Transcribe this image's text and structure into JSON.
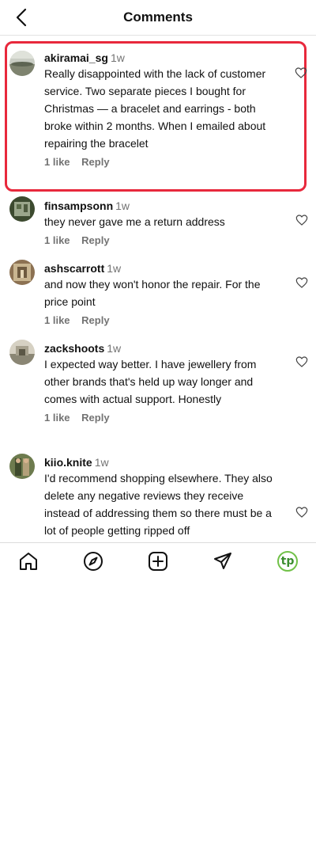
{
  "header": {
    "title": "Comments"
  },
  "comments": [
    {
      "username": "akiramai_sg",
      "time": "1w",
      "text": "Really disappointed with the lack of customer service. Two separate pieces I bought for Christmas — a bracelet and earrings - both broke within 2 months. When I emailed about repairing the bracelet",
      "likes": "1 like",
      "reply": "Reply"
    },
    {
      "username": "finsampsonn",
      "time": "1w",
      "text": "they never gave me a return address",
      "likes": "1 like",
      "reply": "Reply"
    },
    {
      "username": "ashscarrott",
      "time": "1w",
      "text": "and now they won't honor the repair. For the price point",
      "likes": "1 like",
      "reply": "Reply"
    },
    {
      "username": "zackshoots",
      "time": "1w",
      "text": "I expected way better. I have jewellery from other brands that's held up way longer and comes with actual support. Honestly",
      "likes": "1 like",
      "reply": "Reply"
    },
    {
      "username": "kiio.knite",
      "time": "1w",
      "text": "I'd recommend shopping elsewhere. They also delete any negative reviews they receive instead of addressing them so there must be a lot of people getting ripped off",
      "likes": "",
      "reply": ""
    }
  ],
  "nav": {
    "items": [
      "home-icon",
      "explore-compass-icon",
      "create-post-icon",
      "send-message-icon",
      "profile-avatar"
    ],
    "profile_initials": "tp"
  },
  "colors": {
    "highlight_border": "#e8283c",
    "profile_ring": "#71c148",
    "muted_text": "#737373"
  }
}
